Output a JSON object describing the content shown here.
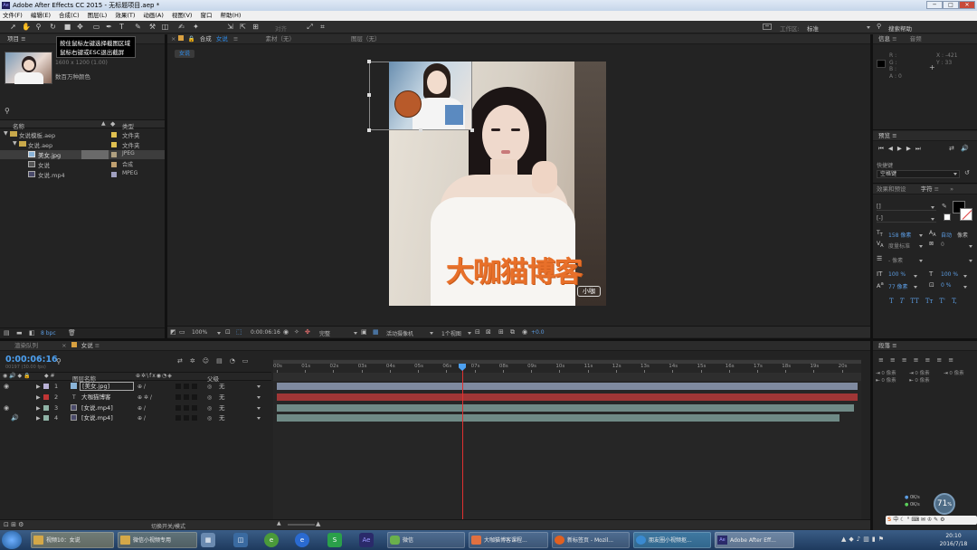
{
  "window": {
    "title": "Adobe After Effects CC 2015 - 无标题项目.aep *",
    "app_icon": "Ae",
    "minimize": "─",
    "maximize": "□",
    "close": "✕"
  },
  "menu": [
    "文件(F)",
    "编辑(E)",
    "合成(C)",
    "图层(L)",
    "效果(T)",
    "动画(A)",
    "视图(V)",
    "窗口",
    "帮助(H)"
  ],
  "toolbar": {
    "align_label": "对齐",
    "workspace_label": "工作区:",
    "workspace_value": "标准",
    "search_help": "搜索帮助"
  },
  "tooltip": {
    "line1": "按住鼠标左键选择截图区域",
    "line2": "鼠标右键或ESC退出截屏"
  },
  "project": {
    "tab": "项目",
    "thumb_dims": "1600 x 1200 (1.00)",
    "thumb_note": "数百万种颜色",
    "col_name": "名称",
    "col_type": "类型",
    "items": [
      {
        "name": "女说模板.aep",
        "type": "文件夹",
        "color": "#e0c050"
      },
      {
        "name": "女说.aep",
        "type": "文件夹",
        "color": "#e0c050"
      },
      {
        "name": "美女.jpg",
        "type": "JPEG",
        "color": "#b0a080"
      },
      {
        "name": "女说",
        "type": "合成",
        "color": "#c0a070"
      },
      {
        "name": "女说.mp4",
        "type": "MPEG",
        "color": "#a0a0c0"
      }
    ],
    "bpc": "8 bpc"
  },
  "composition": {
    "tab_comp": "合成",
    "tab_comp_name": "女说",
    "tab_footage": "素材（无）",
    "tab_layer": "图层（无）",
    "breadcrumb": "女说",
    "overlay_text": "大咖猫博客",
    "watermark": "小咖",
    "zoom": "100%",
    "timecode": "0:00:06:16",
    "quality": "完整",
    "camera": "活动摄像机",
    "views": "1个视图",
    "offset": "+0.0"
  },
  "info": {
    "tab_info": "信息",
    "tab_audio": "音频",
    "r": "R :",
    "g": "G :",
    "b": "B :",
    "a": "A : 0",
    "x": "X : -421",
    "y": "Y : 33"
  },
  "preview": {
    "tab": "预览",
    "shortcut_label": "快捷键",
    "shortcut_value": "空格键"
  },
  "effects": {
    "tab_effects": "效果和预设",
    "tab_char": "字符"
  },
  "character": {
    "font": "[]",
    "style": "[-]",
    "size": "158 像素",
    "leading": "自动",
    "leading_unit": "像素",
    "kerning": "度量标准",
    "tracking": "0",
    "stroke": "- 像素",
    "vscale": "100 %",
    "hscale": "100 %",
    "baseline": "77 像素",
    "tsume": "0 %",
    "styles": [
      "T",
      "T",
      "TT",
      "Tт",
      "T'",
      "T,"
    ]
  },
  "paragraph": {
    "tab": "段落",
    "indent1": "0 像素",
    "indent2": "0 像素",
    "indent3": "0 像素",
    "space1": "0 像素",
    "space2": "0 像素"
  },
  "timeline": {
    "tab_render": "渲染队列",
    "tab_comp": "女说",
    "timecode": "0:00:06:16",
    "fps": "00197 (30.00 fps)",
    "col_layer": "图层名称",
    "col_parent": "父级",
    "toggle_label": "切换开关/模式",
    "ruler": [
      "00s",
      "01s",
      "02s",
      "03s",
      "04s",
      "05s",
      "06s",
      "07s",
      "08s",
      "09s",
      "10s",
      "11s",
      "12s",
      "13s",
      "14s",
      "15s",
      "16s",
      "17s",
      "18s",
      "19s",
      "20s"
    ],
    "layers": [
      {
        "num": "1",
        "name": "[美女.jpg]",
        "parent": "无",
        "color": "#b9b1d6",
        "bar": "#7f8aa0"
      },
      {
        "num": "2",
        "name": "大咖猫博客",
        "parent": "无",
        "color": "#c03535",
        "bar": "#a03636"
      },
      {
        "num": "3",
        "name": "[女说.mp4]",
        "parent": "无",
        "color": "#8fb3a6",
        "bar": "#6f8a86"
      },
      {
        "num": "4",
        "name": "[女说.mp4]",
        "parent": "无",
        "color": "#8fb3a6",
        "bar": "#6f8a86"
      }
    ]
  },
  "network": {
    "up": "0K/s",
    "down": "0K/s",
    "cpu": "71",
    "cpu_unit": "%"
  },
  "taskbar": {
    "items": [
      {
        "label": "视频10：女说",
        "color": "#d4a848"
      },
      {
        "label": "微信小视频专用",
        "color": "#d4a848"
      },
      {
        "label": "微信",
        "color": "#6ab04c"
      },
      {
        "label": "大咖猫博客课程...",
        "color": "#e07040"
      },
      {
        "label": "新标签页 - Mozil...",
        "color": "#e06020"
      },
      {
        "label": "朋友圈小视频抠...",
        "color": "#3a8ad0"
      },
      {
        "label": "Adobe After Eff...",
        "color": "#2a2a6a"
      }
    ],
    "time": "20:10",
    "date": "2016/7/18",
    "ime": "中"
  }
}
